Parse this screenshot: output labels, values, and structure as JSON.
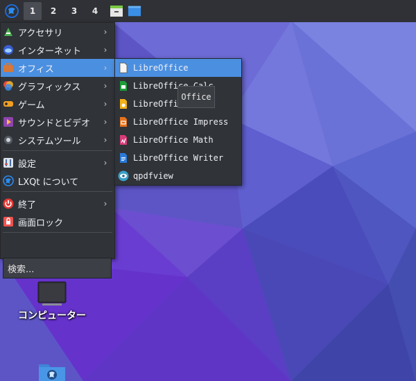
{
  "panel": {
    "desktops": [
      "1",
      "2",
      "3",
      "4"
    ],
    "active_desktop": "1"
  },
  "main_menu": {
    "items": [
      {
        "label": "アクセサリ",
        "icon": "accessories-icon",
        "submenu": true
      },
      {
        "label": "インターネット",
        "icon": "internet-icon",
        "submenu": true
      },
      {
        "label": "オフィス",
        "icon": "office-icon",
        "submenu": true,
        "highlighted": true
      },
      {
        "label": "グラフィックス",
        "icon": "graphics-icon",
        "submenu": true
      },
      {
        "label": "ゲーム",
        "icon": "games-icon",
        "submenu": true
      },
      {
        "label": "サウンドとビデオ",
        "icon": "multimedia-icon",
        "submenu": true
      },
      {
        "label": "システムツール",
        "icon": "system-tools-icon",
        "submenu": true
      },
      {
        "label": "設定",
        "icon": "settings-icon",
        "submenu": true
      },
      {
        "label": "LXQt について",
        "icon": "lxqt-icon",
        "submenu": false
      },
      {
        "label": "終了",
        "icon": "power-icon",
        "submenu": true
      },
      {
        "label": "画面ロック",
        "icon": "lock-icon",
        "submenu": false
      }
    ],
    "search_placeholder": "検索..."
  },
  "office_submenu": {
    "items": [
      {
        "label": "LibreOffice",
        "icon": "libreoffice-icon",
        "highlighted": true
      },
      {
        "label": "LibreOffice Calc",
        "icon": "libreoffice-calc-icon"
      },
      {
        "label": "LibreOffice Draw",
        "icon": "libreoffice-draw-icon"
      },
      {
        "label": "LibreOffice Impress",
        "icon": "libreoffice-impress-icon"
      },
      {
        "label": "LibreOffice Math",
        "icon": "libreoffice-math-icon"
      },
      {
        "label": "LibreOffice Writer",
        "icon": "libreoffice-writer-icon"
      },
      {
        "label": "qpdfview",
        "icon": "qpdfview-icon"
      }
    ]
  },
  "tooltip": {
    "text": "Office"
  },
  "desktop_icons": [
    {
      "label": "コンピューター",
      "icon": "computer-icon"
    },
    {
      "label": "",
      "icon": "network-folder-icon"
    }
  ],
  "colors": {
    "panel": "#2f3136",
    "menu_bg": "#303338",
    "highlight": "#4b8fe0",
    "wallpaper_base": "#5e55c8"
  }
}
